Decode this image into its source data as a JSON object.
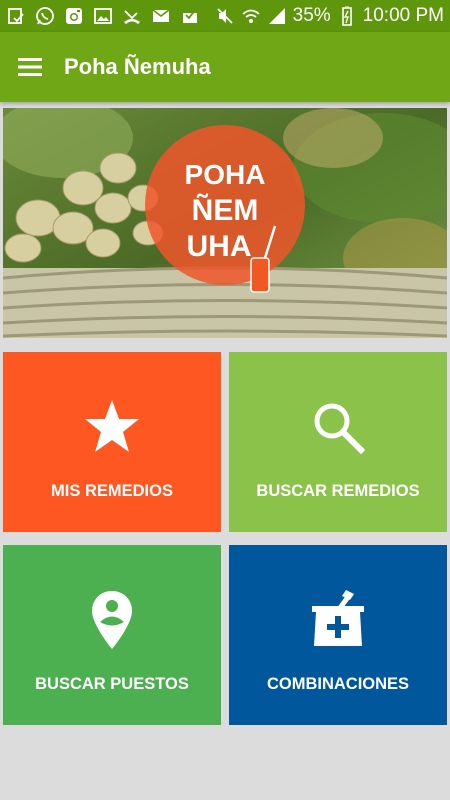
{
  "status_bar": {
    "battery_percent": "35%",
    "time": "10:00 PM",
    "icons": [
      "notification-check-icon",
      "whatsapp-icon",
      "instagram-icon",
      "image-icon",
      "missed-call-icon",
      "mail-icon",
      "inbox-icon",
      "mute-icon",
      "wifi-icon",
      "signal-icon",
      "battery-icon"
    ]
  },
  "app_bar": {
    "title": "Poha Ñemuha",
    "menu_icon": "hamburger-menu-icon"
  },
  "banner": {
    "logo_lines": [
      "POHA",
      "ÑEM",
      "UHA"
    ]
  },
  "tiles": [
    {
      "label": "MIS REMEDIOS",
      "icon": "star-icon",
      "color": "#ff5722"
    },
    {
      "label": "BUSCAR REMEDIOS",
      "icon": "search-icon",
      "color": "#8bc34a"
    },
    {
      "label": "BUSCAR PUESTOS",
      "icon": "location-person-icon",
      "color": "#4caf50"
    },
    {
      "label": "COMBINACIONES",
      "icon": "mortar-pestle-icon",
      "color": "#01579b"
    }
  ],
  "colors": {
    "status_bar": "#5e960c",
    "app_bar": "#6fa717",
    "background": "#dcdcdc"
  }
}
